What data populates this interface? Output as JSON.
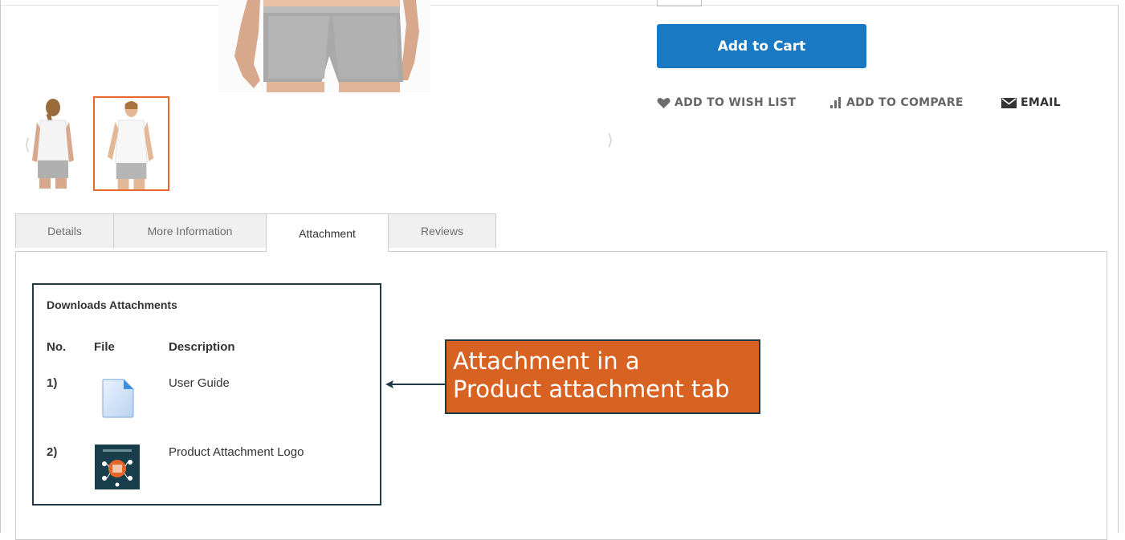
{
  "product": {
    "add_to_cart_label": "Add to Cart",
    "actions": {
      "wishlist_label": "Add to Wish List",
      "compare_label": "Add to Compare",
      "email_label": "Email"
    }
  },
  "gallery": {
    "prev_icon": "chevron-left-icon",
    "next_icon": "chevron-right-icon",
    "selected_thumb_border": "#e8672b"
  },
  "tabs": [
    {
      "label": "Details",
      "active": false
    },
    {
      "label": "More Information",
      "active": false
    },
    {
      "label": "Attachment",
      "active": true
    },
    {
      "label": "Reviews",
      "active": false
    }
  ],
  "attachments": {
    "title": "Downloads Attachments",
    "columns": {
      "no": "No.",
      "file": "File",
      "description": "Description"
    },
    "rows": [
      {
        "no": "1)",
        "file_icon": "document-icon",
        "description": "User Guide"
      },
      {
        "no": "2)",
        "file_icon": "image-thumbnail",
        "description": "Product Attachment Logo"
      }
    ]
  },
  "callout": {
    "line1": "Attachment in a",
    "line2": "Product attachment tab",
    "color": "#d86222",
    "border_color": "#1f3a44"
  },
  "colors": {
    "primary_button": "#1979c3",
    "callout_bg": "#d86222",
    "box_border": "#1f3a44"
  }
}
